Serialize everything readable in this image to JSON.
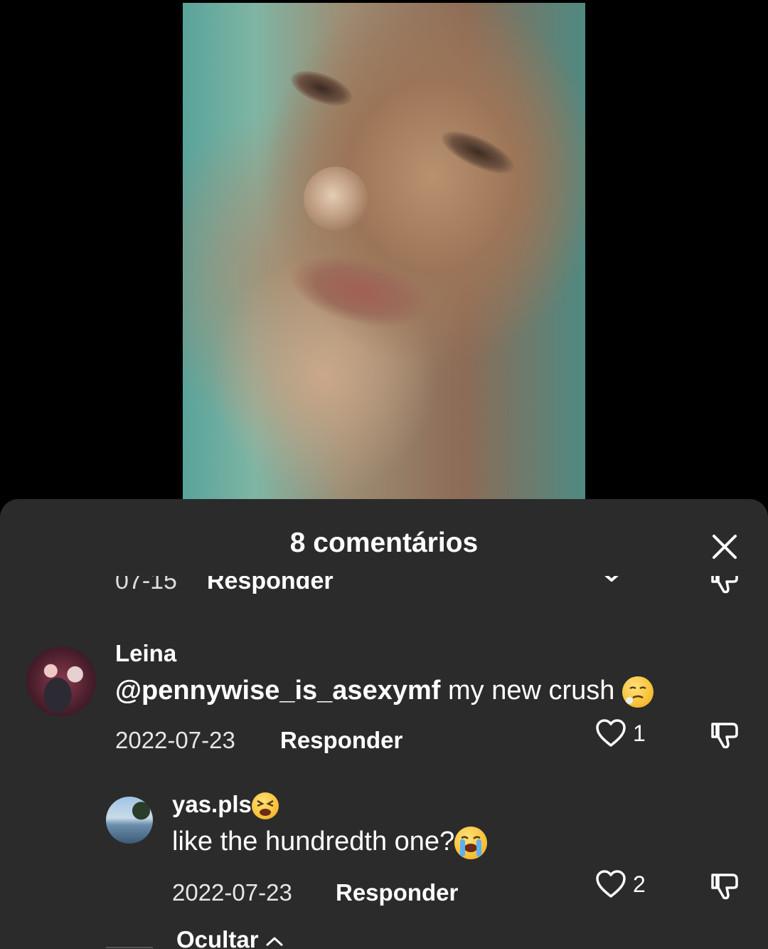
{
  "sheet": {
    "title": "8 comentários"
  },
  "previous_comment": {
    "date": "07-15",
    "reply_label": "Responder"
  },
  "comments": [
    {
      "username": "Leina",
      "mention": "@pennywise_is_asexymf",
      "text": " my new crush ",
      "emoji": "face-exhaling-emoji",
      "date": "2022-07-23",
      "reply_label": "Responder",
      "likes": "1"
    },
    {
      "username": "yas.pls",
      "username_emoji": "tired-face-emoji",
      "text": "like the hundredth one?",
      "emoji": "crying-face-emoji",
      "date": "2022-07-23",
      "reply_label": "Responder",
      "likes": "2"
    }
  ],
  "hide_label": "Ocultar",
  "colors": {
    "sheet_bg": "#2b2b2b",
    "page_bg": "#000000",
    "text": "#ffffff"
  }
}
